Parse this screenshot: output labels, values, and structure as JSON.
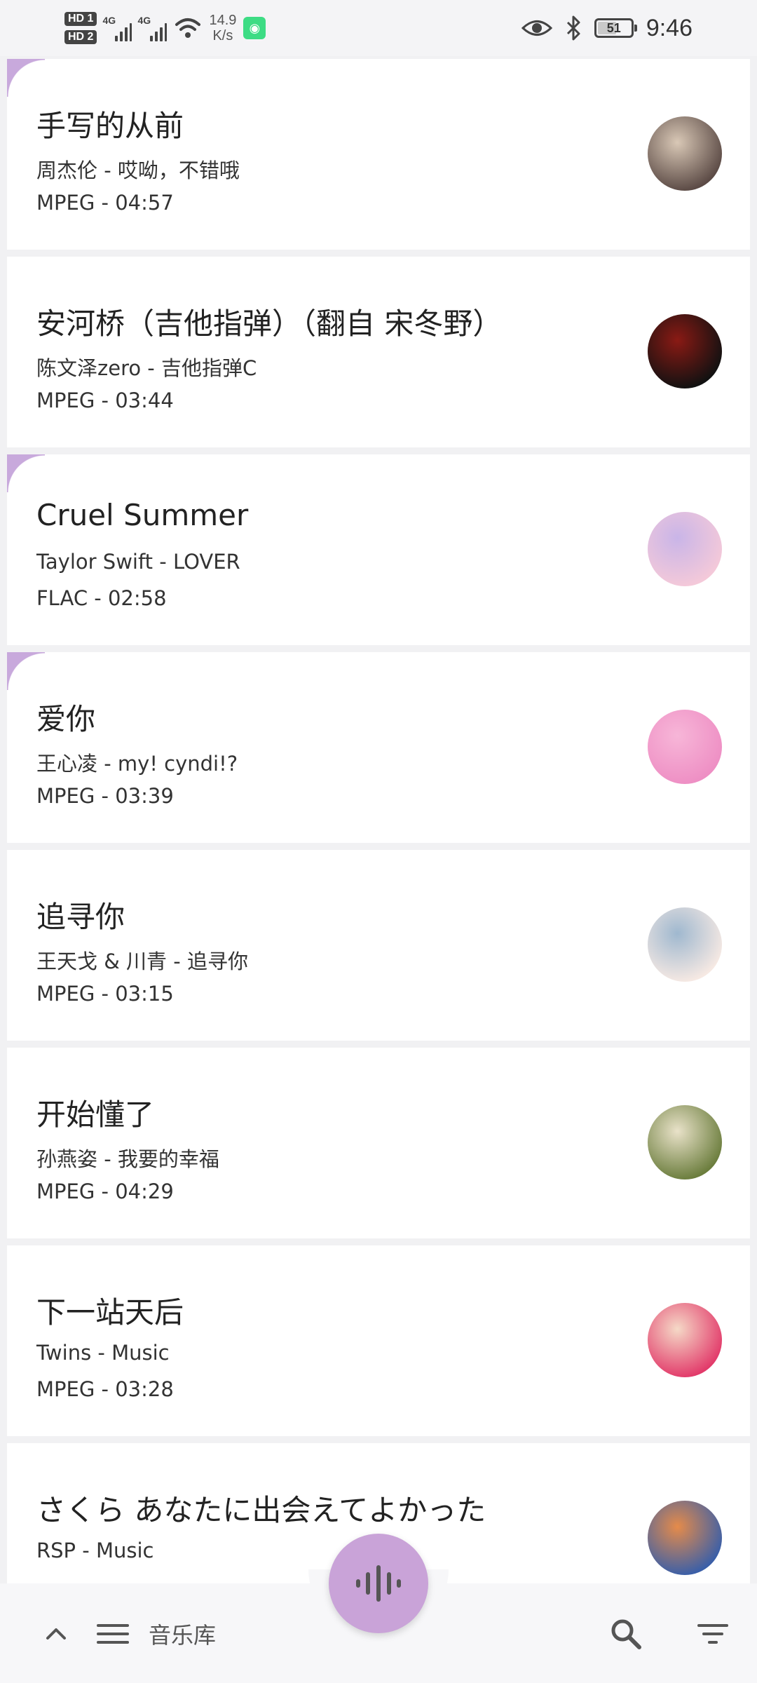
{
  "status_bar": {
    "hd1": "HD 1",
    "hd2": "HD 2",
    "signal1_label": "4G",
    "signal2_label": "4G",
    "net_speed_value": "14.9",
    "net_speed_unit": "K/s",
    "battery": "51",
    "time": "9:46"
  },
  "songs": [
    {
      "title": "手写的从前",
      "artist_album": "周杰伦 - 哎呦，不错哦",
      "format_duration": "MPEG - 04:57",
      "highlight": true,
      "cover_colors": [
        "#5b4a45",
        "#d9c8b6"
      ]
    },
    {
      "title": "安河桥（吉他指弹）（翻自 宋冬野）",
      "artist_album": "陈文泽zero - 吉他指弹C",
      "format_duration": "MPEG - 03:44",
      "highlight": false,
      "cover_colors": [
        "#111111",
        "#8a1a14"
      ]
    },
    {
      "title": "Cruel Summer",
      "artist_album": "Taylor Swift - LOVER",
      "format_duration": "FLAC - 02:58",
      "highlight": true,
      "cover_colors": [
        "#f4c9d9",
        "#c9b5e8"
      ]
    },
    {
      "title": "爱你",
      "artist_album": "王心凌 - my! cyndi!?",
      "format_duration": "MPEG - 03:39",
      "highlight": true,
      "cover_colors": [
        "#ee8fc4",
        "#f7b6d8"
      ]
    },
    {
      "title": "追寻你",
      "artist_album": "王天戈 & 川青 - 追寻你",
      "format_duration": "MPEG - 03:15",
      "highlight": false,
      "cover_colors": [
        "#f6e9e3",
        "#9fb8cf"
      ]
    },
    {
      "title": "开始懂了",
      "artist_album": "孙燕姿 - 我要的幸福",
      "format_duration": "MPEG - 04:29",
      "highlight": false,
      "cover_colors": [
        "#6b7d3d",
        "#e9e2c9"
      ]
    },
    {
      "title": "下一站天后",
      "artist_album": "Twins - Music",
      "format_duration": "MPEG - 03:28",
      "highlight": false,
      "cover_colors": [
        "#e23a6a",
        "#f5d9c7"
      ]
    },
    {
      "title": "さくら あなたに出会えてよかった",
      "artist_album": "RSP - Music",
      "format_duration": "",
      "highlight": false,
      "cover_colors": [
        "#3a5fa8",
        "#e58b4a"
      ]
    }
  ],
  "bottom_bar": {
    "library_label": "音乐库"
  },
  "colors": {
    "accent": "#c9a3d8",
    "highlight_corner": "#c8a9dc",
    "background": "#f1f1f3"
  }
}
